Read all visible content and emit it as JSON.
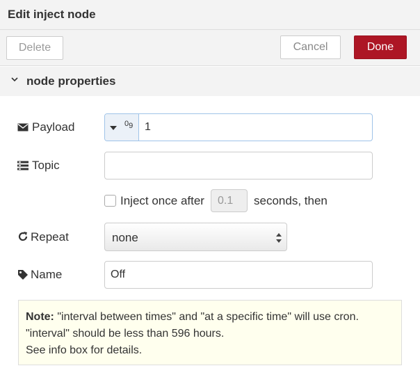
{
  "tray": {
    "title": "Edit inject node",
    "delete_label": "Delete",
    "cancel_label": "Cancel",
    "done_label": "Done"
  },
  "section": {
    "title": "node properties"
  },
  "fields": {
    "payload": {
      "label": "Payload",
      "type_icon": "number-type-icon",
      "type_glyph_top": "0",
      "type_glyph_bottom": "9",
      "value": "1"
    },
    "topic": {
      "label": "Topic",
      "value": ""
    },
    "inject_once": {
      "label": "Inject once after",
      "checked": false,
      "delay_value": "0.1",
      "suffix": "seconds, then"
    },
    "repeat": {
      "label": "Repeat",
      "selected": "none"
    },
    "name": {
      "label": "Name",
      "value": "Off"
    }
  },
  "note": {
    "heading": "Note:",
    "line1": "\"interval between times\" and \"at a specific time\" will use cron.",
    "line2": "\"interval\" should be less than 596 hours.",
    "line3": "See info box for details."
  },
  "colors": {
    "done_button": "#ad1625",
    "header_bg": "#f3f3f3",
    "note_bg": "#ffffee",
    "focus_border": "#9fc3e8"
  }
}
